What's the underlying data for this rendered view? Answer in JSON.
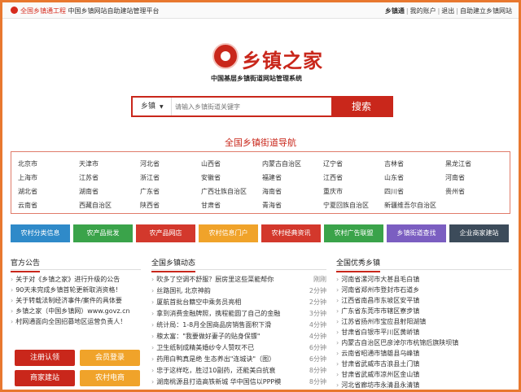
{
  "topbar": {
    "site_link": "全国乡镇通工程",
    "site_desc": "中国乡镇网站自助建站管理平台",
    "site_name": "乡镇通",
    "my_account": "我的账户",
    "logout": "退出",
    "self_build": "自助建立乡镇网站",
    "sep": "|"
  },
  "logo": {
    "name": "乡镇之家",
    "subtitle": "中国基层乡镇街道网站管理系统"
  },
  "search": {
    "category": "乡镇",
    "placeholder": "请输入乡镇街道关键字",
    "button": "搜索"
  },
  "nav_title": "全国乡镇街道导航",
  "regions": [
    [
      "北京市",
      "天津市",
      "河北省",
      "山西省",
      "内蒙古自治区",
      "辽宁省",
      "吉林省",
      "黑龙江省"
    ],
    [
      "上海市",
      "江苏省",
      "浙江省",
      "安徽省",
      "福建省",
      "江西省",
      "山东省",
      "河南省"
    ],
    [
      "湖北省",
      "湖南省",
      "广东省",
      "广西壮族自治区",
      "海南省",
      "重庆市",
      "四川省",
      "贵州省"
    ],
    [
      "云南省",
      "西藏自治区",
      "陕西省",
      "甘肃省",
      "青海省",
      "宁夏回族自治区",
      "新疆维吾尔自治区",
      ""
    ]
  ],
  "categories": [
    {
      "label": "农村分类信息",
      "color": "#2f8ac9"
    },
    {
      "label": "农产品批发",
      "color": "#3aa34a"
    },
    {
      "label": "农产品网店",
      "color": "#d3382c"
    },
    {
      "label": "农村信息门户",
      "color": "#f0a32a"
    },
    {
      "label": "农村经典资讯",
      "color": "#d3382c"
    },
    {
      "label": "农村广告联盟",
      "color": "#3aa34a"
    },
    {
      "label": "乡镇街道查找",
      "color": "#7b5ec1"
    },
    {
      "label": "企业商家建站",
      "color": "#3c4b5a"
    }
  ],
  "announce": {
    "title": "官方公告",
    "items": [
      "关于对《乡镇之家》进行升级的公告",
      "90天未完成乡镇首轮更新取消资格！",
      "关于转载法制经济事件/案件的具体要",
      "乡镇之家（中国乡镇网）www.govz.cn",
      "村网通面向全国招募地区运营负责人！"
    ],
    "actions": [
      "注册认领",
      "会员登录",
      "商家建站",
      "农村电商"
    ]
  },
  "news": {
    "title": "全国乡镇动态",
    "items": [
      {
        "text": "吹多了空调不舒服？厨房里这些菜能帮你",
        "time": "刚刚"
      },
      {
        "text": "丝路国礼 北京神韵",
        "time": "2分钟"
      },
      {
        "text": "厦航首批台籍空中乘务员亮相",
        "time": "2分钟"
      },
      {
        "text": "拿到消费金融牌照，携程能圆了自己的金融",
        "time": "3分钟"
      },
      {
        "text": "统计局：1-8月全国商品房销售面积下滑",
        "time": "4分钟"
      },
      {
        "text": "粮太富：\"我要做好妻子的贴身保镖\"",
        "time": "4分钟"
      },
      {
        "text": "卫生纸制成精美婚纱令人赞叹不已",
        "time": "6分钟"
      },
      {
        "text": "药用白鸭真是绝 生态养出\"连城诀\"（图）",
        "time": "6分钟"
      },
      {
        "text": "忠于这样吃，胜过10副药，还能美白抗衰",
        "time": "8分钟"
      },
      {
        "text": "湖南桃源县打造高铁新城 华中国信以PPP模",
        "time": "8分钟"
      }
    ]
  },
  "towns": {
    "title": "全国优秀乡镇",
    "items": [
      "河南省漯河市大甚县毛白镇",
      "河南省郑州市登封市石道乡",
      "江西省南昌市东坡区安平镇",
      "广东省东莞市市辖区寮步镇",
      "江苏省扬州市宝应县射阳湖镇",
      "甘肃省白银市平川区黄峤镇",
      "内蒙古自治区巴彦淖尔市杭锦后旗陕坝镇",
      "云南省昭通市镇雄县乌峰镇",
      "甘肃省武威市古浪县土门镇",
      "甘肃省武威市凉州区金山镇",
      "河北省廊坊市永清县永清镇"
    ]
  }
}
